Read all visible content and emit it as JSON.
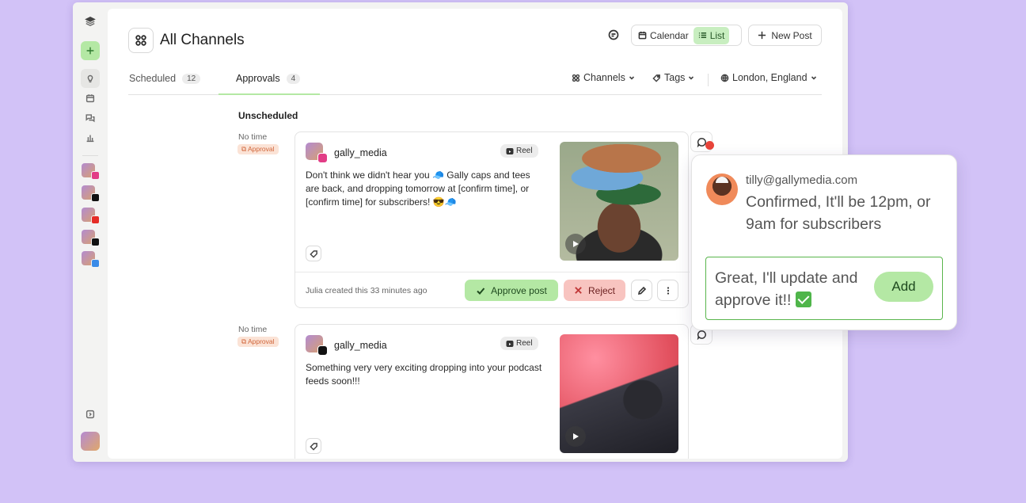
{
  "header": {
    "title": "All Channels",
    "calendar_label": "Calendar",
    "list_label": "List",
    "new_post_label": "New Post"
  },
  "tabs": [
    {
      "label": "Scheduled",
      "count": "12"
    },
    {
      "label": "Approvals",
      "count": "4"
    }
  ],
  "filters": {
    "channels": "Channels",
    "tags": "Tags",
    "location": "London, England"
  },
  "section_title": "Unscheduled",
  "posts": [
    {
      "time": "No time",
      "status": "Approval",
      "account": "gally_media",
      "type": "Reel",
      "network": "instagram",
      "text": "Don't think we didn't hear you 🧢 Gally caps and tees are back, and dropping tomorrow at [confirm time], or [confirm time] for subscribers! 😎🧢",
      "created": "Julia created this 33 minutes ago",
      "approve_label": "Approve post",
      "reject_label": "Reject"
    },
    {
      "time": "No time",
      "status": "Approval",
      "account": "gally_media",
      "type": "Reel",
      "network": "tiktok",
      "text": "Something very very exciting dropping into your podcast feeds soon!!!"
    }
  ],
  "comment_popover": {
    "author_email": "tilly@gallymedia.com",
    "message": "Confirmed, It'll be 12pm, or 9am for subscribers",
    "reply_text": "Great, I'll update and approve it!!",
    "add_label": "Add"
  },
  "sidebar": {
    "channel_networks": [
      "instagram",
      "tiktok",
      "youtube",
      "x",
      "bluesky"
    ]
  },
  "colors": {
    "background": "#d2c2f7",
    "accent_green": "#b4e8a4",
    "reject_red": "#f8c4c0",
    "approval_badge": "#fbe3d6"
  }
}
